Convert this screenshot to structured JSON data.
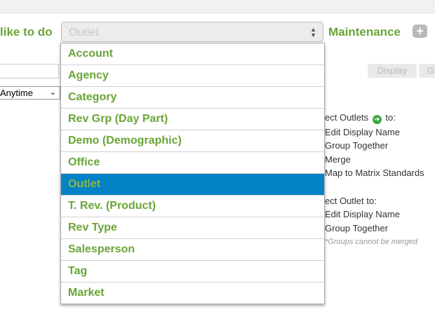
{
  "header": {
    "like_to_do": "like to do",
    "maintenance": "Maintenance",
    "plus": "+"
  },
  "select": {
    "value": "Outlet",
    "arrows_up": "▲",
    "arrows_down": "▼"
  },
  "filters": {
    "time_value": "Anytime",
    "time_chevron": "⌄"
  },
  "buttons": {
    "display": "Display",
    "g": "G"
  },
  "info": {
    "outlets_prefix": "ect Outlets",
    "go_glyph": "➜",
    "outlets_suffix": "to:",
    "outlets_options": [
      "Edit Display Name",
      "Group Together",
      "Merge",
      "Map to Matrix Standards"
    ],
    "outlet_prefix": "ect Outlet to:",
    "outlet_options": [
      "Edit Display Name",
      "Group Together"
    ],
    "note": "*Groups cannot be merged"
  },
  "dropdown": {
    "items": [
      "Account",
      "Agency",
      "Category",
      "Rev Grp (Day Part)",
      "Demo (Demographic)",
      "Office",
      "Outlet",
      "T. Rev. (Product)",
      "Rev Type",
      "Salesperson",
      "Tag",
      "Market"
    ],
    "selected_index": 6
  }
}
